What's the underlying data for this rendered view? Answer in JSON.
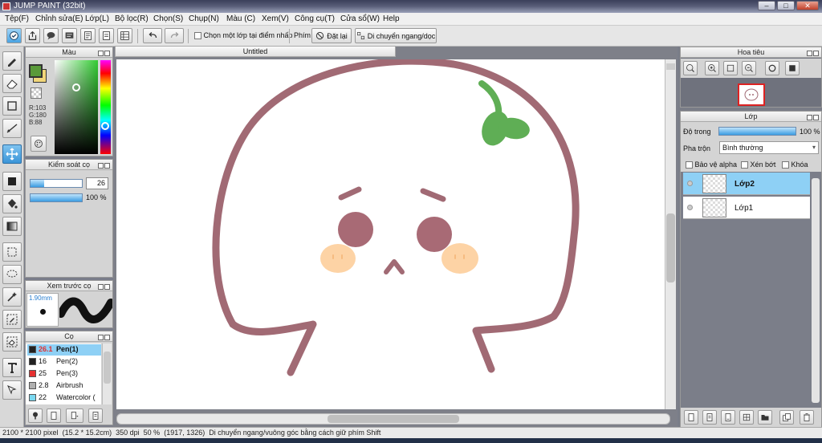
{
  "window": {
    "title": "JUMP PAINT (32bit)",
    "controls": [
      "minimize-icon",
      "maximize-icon",
      "close-icon"
    ]
  },
  "menu": [
    "Tệp(F)",
    "Chỉnh sửa(E)",
    "Lớp(L)",
    "Bộ lọc(R)",
    "Chọn(S)",
    "Chụp(N)",
    "Màu (C)",
    "Xem(V)",
    "Công cụ(T)",
    "Cửa sổ(W)",
    "Help"
  ],
  "toolbar": {
    "select_one_layer": "Chọn một lớp tại điểm nhấp",
    "keys_label": "Phím",
    "reset_label": "Đặt lại",
    "move_label": "Di chuyển ngang/dọc"
  },
  "color_panel": {
    "title": "Màu",
    "fg_color": "#5a9a3a",
    "bg_color": "#f1d67a",
    "r": "R:103",
    "g": "G:180",
    "b": "B:88"
  },
  "brush_control": {
    "title": "Kiểm soát cọ",
    "size_value": "26",
    "opacity_value": "100 %",
    "size_fraction": 0.26,
    "opacity_fraction": 1.0
  },
  "brush_preview": {
    "title": "Xem trước cọ",
    "size": "1.90mm"
  },
  "brush_list": {
    "title": "Cọ",
    "items": [
      {
        "size": "26.1",
        "name": "Pen(1)",
        "color": "#222222",
        "selected": true
      },
      {
        "size": "16",
        "name": "Pen(2)",
        "color": "#222222",
        "selected": false
      },
      {
        "size": "25",
        "name": "Pen(3)",
        "color": "#e53030",
        "selected": false
      },
      {
        "size": "2.8",
        "name": "Airbrush",
        "color": "#b0b0b0",
        "selected": false
      },
      {
        "size": "22",
        "name": "Watercolor (",
        "color": "#7ad8f0",
        "selected": false
      }
    ]
  },
  "document": {
    "tab_title": "Untitled"
  },
  "navigator": {
    "title": "Hoa tiêu"
  },
  "layer_panel": {
    "title": "Lớp",
    "opacity_label": "Độ trong",
    "opacity_value": "100 %",
    "opacity_fraction": 1.0,
    "blend_label": "Pha trộn",
    "blend_value": "Bình thường",
    "protect_alpha": "Bảo vệ alpha",
    "clipping": "Xén bớt",
    "lock": "Khóa",
    "layers": [
      {
        "name": "Lớp2",
        "selected": true
      },
      {
        "name": "Lớp1",
        "selected": false
      }
    ]
  },
  "status": {
    "dimensions": "2100 * 2100 pixel",
    "physical": "(15.2 * 15.2cm)",
    "dpi": "350 dpi",
    "zoom": "50 %",
    "coords": "(1917, 1326)",
    "hint": "Di chuyển ngang/vuông góc bằng cách giữ phím Shift"
  },
  "artwork_colors": {
    "outline": "#a16a74",
    "cheeks": "#fdd3a5",
    "eyes": "#a86a75",
    "leaf": "#5fae55"
  }
}
